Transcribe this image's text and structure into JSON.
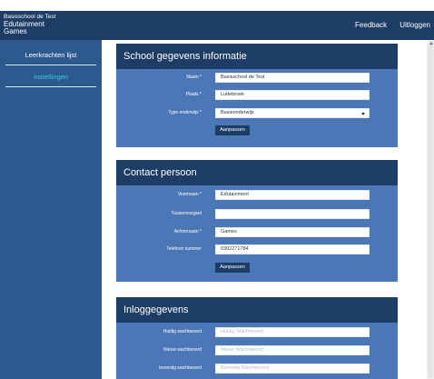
{
  "header": {
    "school_name": "Basisschool de Test",
    "app_name_line1": "Edutainment",
    "app_name_line2": "Games",
    "nav": [
      "Feedback",
      "Uitloggen"
    ]
  },
  "sidebar": {
    "items": [
      {
        "label": "Leerkrachten lijst",
        "active": false
      },
      {
        "label": "Instellingen",
        "active": true
      }
    ]
  },
  "colors": {
    "header_bg": "#1d3c66",
    "sidebar_bg": "#2d5a8e",
    "panel_bg": "#4c77b7",
    "active_link": "#39c7e7"
  },
  "school_panel": {
    "title": "School gegevens informatie",
    "fields": [
      {
        "label": "Naam *",
        "value": "Basisschool de Test",
        "placeholder": ""
      },
      {
        "label": "Plaats *",
        "value": "Luttebroek",
        "placeholder": ""
      },
      {
        "label": "Type onderwijs *",
        "value": "Basisonderwijs",
        "placeholder": ""
      }
    ],
    "button": "Aanpassen"
  },
  "contact_panel": {
    "title": "Contact persoon",
    "fields": [
      {
        "label": "Voornaam *",
        "value": "Edutainment",
        "placeholder": ""
      },
      {
        "label": "Tussenvoegsel",
        "value": "",
        "placeholder": ""
      },
      {
        "label": "Achternaam *",
        "value": "Games",
        "placeholder": ""
      },
      {
        "label": "Telefoon nummer",
        "value": "0302271784",
        "placeholder": ""
      }
    ],
    "button": "Aanpassen"
  },
  "login_panel": {
    "title": "Inloggegevens",
    "fields": [
      {
        "label": "Huidig wachtwoord",
        "value": "",
        "placeholder": "Huidig Wachtwoord"
      },
      {
        "label": "Nieuw wachtwoord",
        "value": "",
        "placeholder": "Nieuw Wachtwoord"
      },
      {
        "label": "bevestig wachtwoord",
        "value": "",
        "placeholder": "Bevestig Wachtwoord"
      }
    ]
  }
}
